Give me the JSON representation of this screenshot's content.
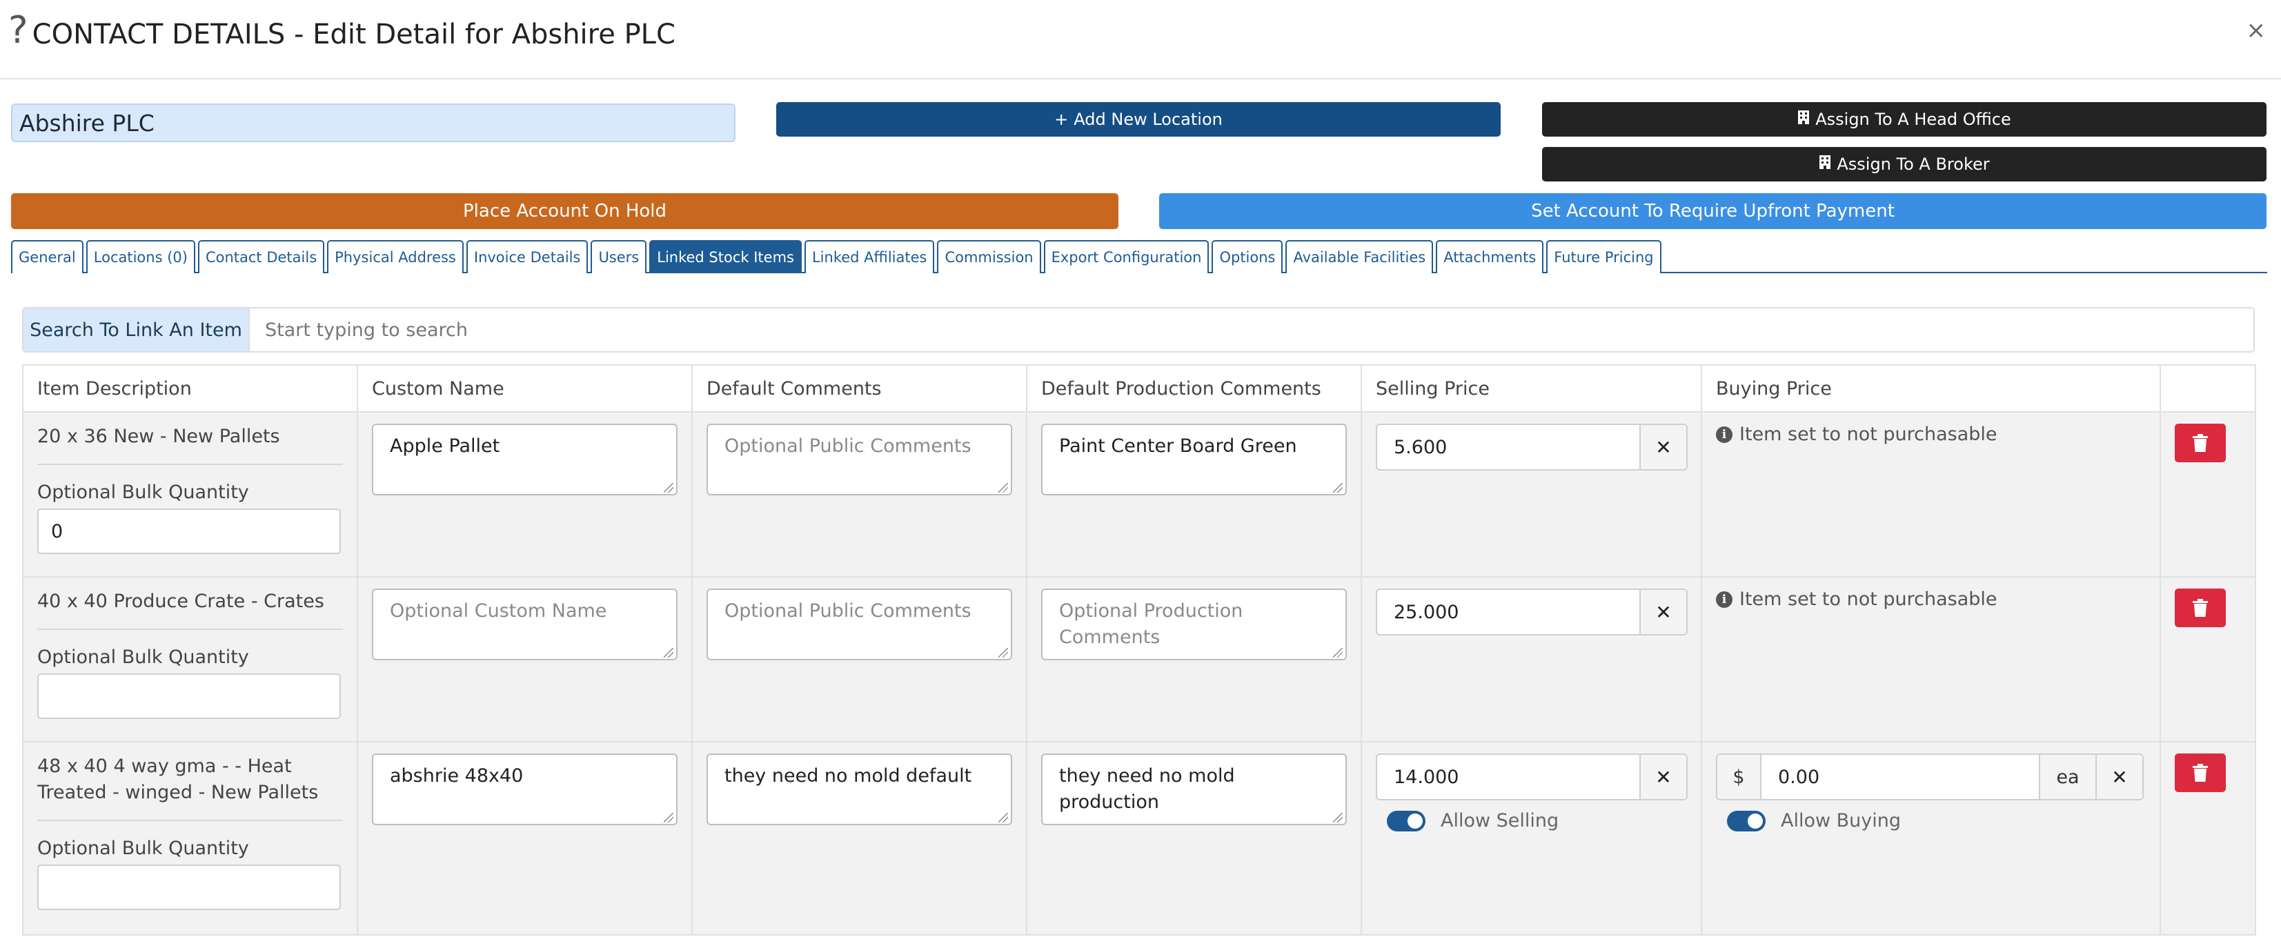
{
  "header": {
    "help_icon": "?",
    "title": "CONTACT DETAILS - Edit Detail for Abshire PLC",
    "close": "×"
  },
  "account": {
    "name": "Abshire PLC"
  },
  "actions": {
    "add_location": "Add New Location",
    "assign_head_office": "Assign To A Head Office",
    "assign_broker": "Assign To A Broker",
    "place_on_hold": "Place Account On Hold",
    "require_upfront": "Set Account To Require Upfront Payment",
    "colors": {
      "primary_dark": "#154d85",
      "dark": "#232323",
      "warning": "#c8681e",
      "info": "#3b8fe2",
      "danger": "#db2a3e"
    }
  },
  "tabs": [
    {
      "label": "General"
    },
    {
      "label": "Locations (0)"
    },
    {
      "label": "Contact Details"
    },
    {
      "label": "Physical Address"
    },
    {
      "label": "Invoice Details"
    },
    {
      "label": "Users"
    },
    {
      "label": "Linked Stock Items",
      "active": true
    },
    {
      "label": "Linked Affiliates"
    },
    {
      "label": "Commission"
    },
    {
      "label": "Export Configuration"
    },
    {
      "label": "Options"
    },
    {
      "label": "Available Facilities"
    },
    {
      "label": "Attachments"
    },
    {
      "label": "Future Pricing"
    }
  ],
  "search": {
    "label": "Search To Link An Item",
    "placeholder": "Start typing to search"
  },
  "table": {
    "columns": [
      "Item Description",
      "Custom Name",
      "Default Comments",
      "Default Production Comments",
      "Selling Price",
      "Buying Price",
      ""
    ],
    "bulk_label": "Optional Bulk Quantity",
    "rows": [
      {
        "description": "20 x 36 New - New Pallets",
        "bulk_quantity": "0",
        "custom_name": "Apple Pallet",
        "custom_name_placeholder": "Optional Custom Name",
        "default_comments": "",
        "default_comments_placeholder": "Optional Public Comments",
        "production_comments": "Paint Center Board Green",
        "production_comments_placeholder": "Optional Production Comments",
        "selling_price": "5.600",
        "buying_note": "Item set to not purchasable"
      },
      {
        "description": "40 x 40 Produce Crate - Crates",
        "bulk_quantity": "",
        "custom_name": "",
        "custom_name_placeholder": "Optional Custom Name",
        "default_comments": "",
        "default_comments_placeholder": "Optional Public Comments",
        "production_comments": "",
        "production_comments_placeholder": "Optional Production Comments",
        "selling_price": "25.000",
        "buying_note": "Item set to not purchasable"
      },
      {
        "description": "48 x 40 4 way gma - - Heat Treated - winged - New Pallets",
        "bulk_quantity": "",
        "custom_name": "abshrie 48x40",
        "custom_name_placeholder": "Optional Custom Name",
        "default_comments": "they need no mold default",
        "default_comments_placeholder": "Optional Public Comments",
        "production_comments": "they need no mold production",
        "production_comments_placeholder": "Optional Production Comments",
        "selling_price": "14.000",
        "allow_selling_label": "Allow Selling",
        "allow_selling": true,
        "buying_currency": "$",
        "buying_price": "0.00",
        "buying_unit": "ea",
        "allow_buying_label": "Allow Buying",
        "allow_buying": true
      }
    ]
  }
}
